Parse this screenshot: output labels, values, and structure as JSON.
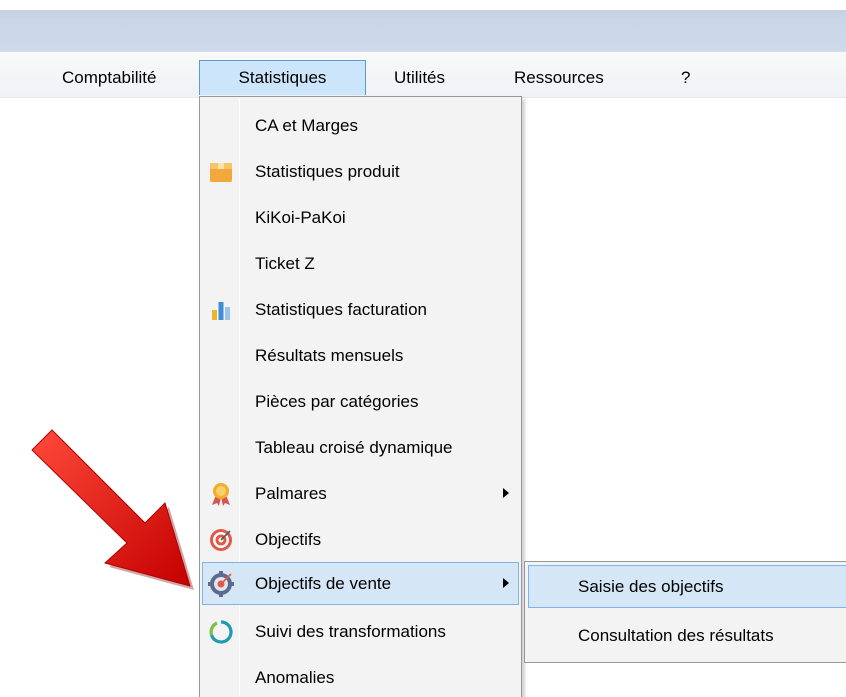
{
  "menubar": {
    "items": [
      {
        "label": "Comptabilité"
      },
      {
        "label": "Statistiques"
      },
      {
        "label": "Utilités"
      },
      {
        "label": "Ressources"
      },
      {
        "label": "?"
      }
    ],
    "active_index": 1
  },
  "statistiques_menu": {
    "items": [
      {
        "label": "CA et Marges",
        "icon": null
      },
      {
        "label": "Statistiques produit",
        "icon": "box-icon"
      },
      {
        "label": "KiKoi-PaKoi",
        "icon": null
      },
      {
        "label": "Ticket Z",
        "icon": null
      },
      {
        "label": "Statistiques facturation",
        "icon": "bar-chart-icon"
      },
      {
        "label": "Résultats mensuels",
        "icon": null
      },
      {
        "label": "Pièces par catégories",
        "icon": null
      },
      {
        "label": "Tableau croisé dynamique",
        "icon": null
      },
      {
        "label": "Palmares",
        "icon": "award-ribbon-icon",
        "has_submenu": true
      },
      {
        "label": "Objectifs",
        "icon": "target-icon"
      },
      {
        "label": "Objectifs de vente",
        "icon": "target-gear-icon",
        "has_submenu": true,
        "highlighted": true
      },
      {
        "label": "Suivi des transformations",
        "icon": "circular-progress-icon"
      },
      {
        "label": "Anomalies",
        "icon": null
      }
    ]
  },
  "objectifs_de_vente_submenu": {
    "items": [
      {
        "label": "Saisie des objectifs",
        "highlighted": true
      },
      {
        "label": "Consultation des résultats"
      }
    ]
  },
  "colors": {
    "highlight_bg": "#d5e6f7",
    "highlight_border": "#7eb4ea",
    "menu_bg": "#f3f3f3",
    "pointer_arrow": "#e81010"
  }
}
